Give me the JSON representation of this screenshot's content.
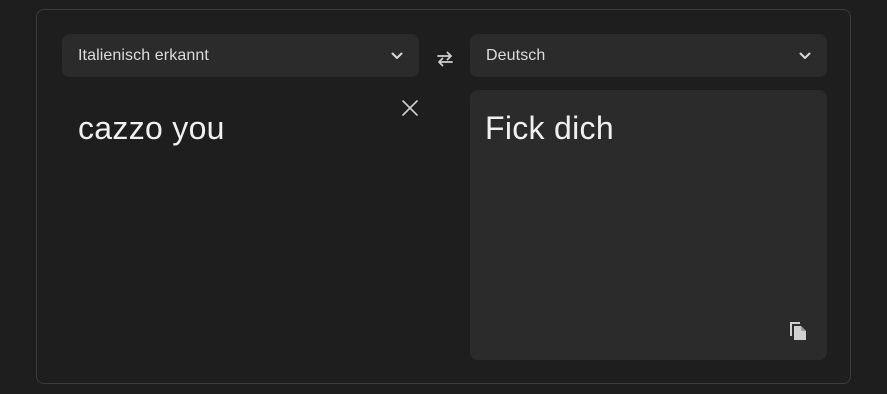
{
  "source_language": {
    "label": "Italienisch erkannt",
    "icon": "chevron-down-icon"
  },
  "target_language": {
    "label": "Deutsch",
    "icon": "chevron-down-icon"
  },
  "swap": {
    "icon": "swap-arrows-icon"
  },
  "source": {
    "text": "cazzo you",
    "clear_icon": "close-icon"
  },
  "target": {
    "text": "Fick dich",
    "copy_icon": "copy-icon"
  },
  "colors": {
    "background": "#1e1e1e",
    "surface": "#2b2b2b",
    "border": "#3d3d3d",
    "text": "#f0f0f0",
    "icon": "#cfcfcf"
  }
}
